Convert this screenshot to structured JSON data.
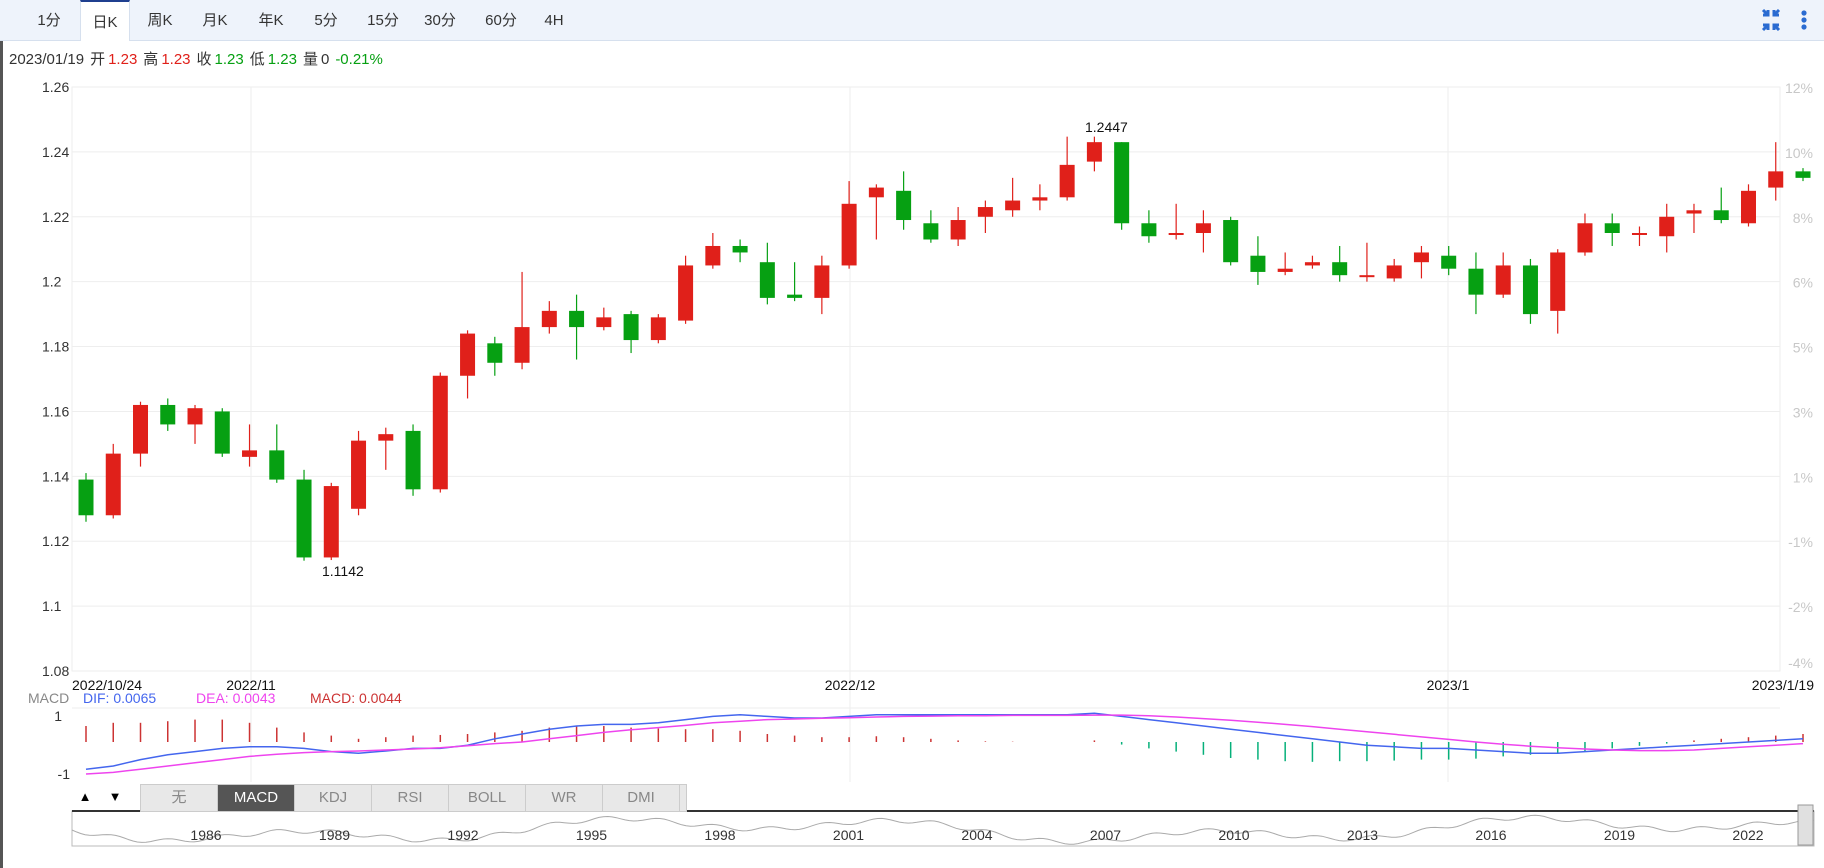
{
  "tabs": [
    {
      "label": "1分",
      "active": false
    },
    {
      "label": "日K",
      "active": true
    },
    {
      "label": "周K",
      "active": false
    },
    {
      "label": "月K",
      "active": false
    },
    {
      "label": "年K",
      "active": false
    },
    {
      "label": "5分",
      "active": false
    },
    {
      "label": "15分",
      "active": false
    },
    {
      "label": "30分",
      "active": false
    },
    {
      "label": "60分",
      "active": false
    },
    {
      "label": "4H",
      "active": false
    }
  ],
  "quote": {
    "date": "2023/01/19",
    "open_label": "开",
    "open": "1.23",
    "high_label": "高",
    "high": "1.23",
    "close_label": "收",
    "close": "1.23",
    "low_label": "低",
    "low": "1.23",
    "volume_label": "量",
    "volume": "0",
    "change": "-0.21%"
  },
  "colors": {
    "up": "#e0201a",
    "down": "#06a012",
    "dif": "#4466ee",
    "dea": "#ee44ee",
    "macd": "#cc3333"
  },
  "macd": {
    "label": "MACD",
    "dif_label": "DIF: 0.0065",
    "dea_label": "DEA: 0.0043",
    "macd_label": "MACD: 0.0044",
    "y_ticks": [
      "1",
      "-1"
    ]
  },
  "indicator_tabs": [
    {
      "label": "无",
      "active": false
    },
    {
      "label": "MACD",
      "active": true
    },
    {
      "label": "KDJ",
      "active": false
    },
    {
      "label": "RSI",
      "active": false
    },
    {
      "label": "BOLL",
      "active": false
    },
    {
      "label": "WR",
      "active": false
    },
    {
      "label": "DMI",
      "active": false
    }
  ],
  "nav_buttons": {
    "up": "▲",
    "down": "▼"
  },
  "overview_years": [
    "1986",
    "1989",
    "1992",
    "1995",
    "1998",
    "2001",
    "2004",
    "2007",
    "2010",
    "2013",
    "2016",
    "2019",
    "2022"
  ],
  "chart_data": {
    "type": "candlestick",
    "y_ticks": [
      "1.26",
      "1.24",
      "1.22",
      "1.2",
      "1.18",
      "1.16",
      "1.14",
      "1.12",
      "1.1",
      "1.08"
    ],
    "ylim": [
      1.08,
      1.26
    ],
    "right_ticks": [
      "12%",
      "10%",
      "8%",
      "6%",
      "5%",
      "3%",
      "1%",
      "-1%",
      "-2%",
      "-4%"
    ],
    "x_labels": [
      "2022/10/24",
      "2022/11",
      "2022/12",
      "2023/1",
      "2023/1/19"
    ],
    "annotations": {
      "high": "1.2447",
      "low": "1.1142"
    },
    "candles": [
      {
        "o": 1.139,
        "h": 1.141,
        "l": 1.126,
        "c": 1.128
      },
      {
        "o": 1.128,
        "h": 1.15,
        "l": 1.127,
        "c": 1.147
      },
      {
        "o": 1.147,
        "h": 1.163,
        "l": 1.143,
        "c": 1.162
      },
      {
        "o": 1.162,
        "h": 1.164,
        "l": 1.154,
        "c": 1.156
      },
      {
        "o": 1.156,
        "h": 1.162,
        "l": 1.15,
        "c": 1.161
      },
      {
        "o": 1.16,
        "h": 1.161,
        "l": 1.146,
        "c": 1.147
      },
      {
        "o": 1.146,
        "h": 1.156,
        "l": 1.143,
        "c": 1.148
      },
      {
        "o": 1.148,
        "h": 1.156,
        "l": 1.138,
        "c": 1.139
      },
      {
        "o": 1.139,
        "h": 1.142,
        "l": 1.114,
        "c": 1.115
      },
      {
        "o": 1.115,
        "h": 1.138,
        "l": 1.1142,
        "c": 1.137
      },
      {
        "o": 1.13,
        "h": 1.154,
        "l": 1.128,
        "c": 1.151
      },
      {
        "o": 1.151,
        "h": 1.155,
        "l": 1.142,
        "c": 1.153
      },
      {
        "o": 1.154,
        "h": 1.156,
        "l": 1.134,
        "c": 1.136
      },
      {
        "o": 1.136,
        "h": 1.172,
        "l": 1.135,
        "c": 1.171
      },
      {
        "o": 1.171,
        "h": 1.185,
        "l": 1.164,
        "c": 1.184
      },
      {
        "o": 1.181,
        "h": 1.183,
        "l": 1.171,
        "c": 1.175
      },
      {
        "o": 1.175,
        "h": 1.203,
        "l": 1.173,
        "c": 1.186
      },
      {
        "o": 1.186,
        "h": 1.194,
        "l": 1.184,
        "c": 1.191
      },
      {
        "o": 1.191,
        "h": 1.196,
        "l": 1.176,
        "c": 1.186
      },
      {
        "o": 1.186,
        "h": 1.192,
        "l": 1.185,
        "c": 1.189
      },
      {
        "o": 1.19,
        "h": 1.191,
        "l": 1.178,
        "c": 1.182
      },
      {
        "o": 1.182,
        "h": 1.19,
        "l": 1.181,
        "c": 1.189
      },
      {
        "o": 1.188,
        "h": 1.208,
        "l": 1.187,
        "c": 1.205
      },
      {
        "o": 1.205,
        "h": 1.215,
        "l": 1.204,
        "c": 1.211
      },
      {
        "o": 1.211,
        "h": 1.213,
        "l": 1.206,
        "c": 1.209
      },
      {
        "o": 1.206,
        "h": 1.212,
        "l": 1.193,
        "c": 1.195
      },
      {
        "o": 1.196,
        "h": 1.206,
        "l": 1.194,
        "c": 1.195
      },
      {
        "o": 1.195,
        "h": 1.208,
        "l": 1.19,
        "c": 1.205
      },
      {
        "o": 1.205,
        "h": 1.231,
        "l": 1.204,
        "c": 1.224
      },
      {
        "o": 1.226,
        "h": 1.23,
        "l": 1.213,
        "c": 1.229
      },
      {
        "o": 1.228,
        "h": 1.234,
        "l": 1.216,
        "c": 1.219
      },
      {
        "o": 1.218,
        "h": 1.222,
        "l": 1.212,
        "c": 1.213
      },
      {
        "o": 1.213,
        "h": 1.223,
        "l": 1.211,
        "c": 1.219
      },
      {
        "o": 1.22,
        "h": 1.225,
        "l": 1.215,
        "c": 1.223
      },
      {
        "o": 1.222,
        "h": 1.232,
        "l": 1.22,
        "c": 1.225
      },
      {
        "o": 1.225,
        "h": 1.23,
        "l": 1.222,
        "c": 1.226
      },
      {
        "o": 1.226,
        "h": 1.2447,
        "l": 1.225,
        "c": 1.236
      },
      {
        "o": 1.237,
        "h": 1.2447,
        "l": 1.234,
        "c": 1.243
      },
      {
        "o": 1.243,
        "h": 1.243,
        "l": 1.216,
        "c": 1.218
      },
      {
        "o": 1.218,
        "h": 1.222,
        "l": 1.212,
        "c": 1.214
      },
      {
        "o": 1.215,
        "h": 1.224,
        "l": 1.213,
        "c": 1.215
      },
      {
        "o": 1.215,
        "h": 1.222,
        "l": 1.209,
        "c": 1.218
      },
      {
        "o": 1.219,
        "h": 1.22,
        "l": 1.205,
        "c": 1.206
      },
      {
        "o": 1.208,
        "h": 1.214,
        "l": 1.199,
        "c": 1.203
      },
      {
        "o": 1.203,
        "h": 1.209,
        "l": 1.202,
        "c": 1.204
      },
      {
        "o": 1.205,
        "h": 1.208,
        "l": 1.204,
        "c": 1.206
      },
      {
        "o": 1.206,
        "h": 1.211,
        "l": 1.2,
        "c": 1.202
      },
      {
        "o": 1.202,
        "h": 1.212,
        "l": 1.2,
        "c": 1.202
      },
      {
        "o": 1.201,
        "h": 1.207,
        "l": 1.2,
        "c": 1.205
      },
      {
        "o": 1.206,
        "h": 1.211,
        "l": 1.201,
        "c": 1.209
      },
      {
        "o": 1.208,
        "h": 1.211,
        "l": 1.202,
        "c": 1.204
      },
      {
        "o": 1.204,
        "h": 1.209,
        "l": 1.19,
        "c": 1.196
      },
      {
        "o": 1.196,
        "h": 1.209,
        "l": 1.195,
        "c": 1.205
      },
      {
        "o": 1.205,
        "h": 1.207,
        "l": 1.187,
        "c": 1.19
      },
      {
        "o": 1.191,
        "h": 1.21,
        "l": 1.184,
        "c": 1.209
      },
      {
        "o": 1.209,
        "h": 1.221,
        "l": 1.208,
        "c": 1.218
      },
      {
        "o": 1.218,
        "h": 1.221,
        "l": 1.211,
        "c": 1.215
      },
      {
        "o": 1.215,
        "h": 1.217,
        "l": 1.211,
        "c": 1.215
      },
      {
        "o": 1.214,
        "h": 1.224,
        "l": 1.209,
        "c": 1.22
      },
      {
        "o": 1.221,
        "h": 1.224,
        "l": 1.215,
        "c": 1.222
      },
      {
        "o": 1.222,
        "h": 1.229,
        "l": 1.218,
        "c": 1.219
      },
      {
        "o": 1.218,
        "h": 1.23,
        "l": 1.217,
        "c": 1.228
      },
      {
        "o": 1.229,
        "h": 1.243,
        "l": 1.225,
        "c": 1.234
      },
      {
        "o": 1.234,
        "h": 1.235,
        "l": 1.231,
        "c": 1.232
      }
    ],
    "macd_series": {
      "dif": [
        -0.85,
        -0.75,
        -0.55,
        -0.4,
        -0.3,
        -0.2,
        -0.15,
        -0.15,
        -0.2,
        -0.3,
        -0.35,
        -0.28,
        -0.2,
        -0.2,
        -0.1,
        0.1,
        0.25,
        0.4,
        0.5,
        0.55,
        0.55,
        0.6,
        0.7,
        0.8,
        0.85,
        0.8,
        0.75,
        0.75,
        0.8,
        0.85,
        0.85,
        0.85,
        0.85,
        0.85,
        0.85,
        0.85,
        0.85,
        0.9,
        0.8,
        0.7,
        0.6,
        0.5,
        0.4,
        0.3,
        0.2,
        0.1,
        0.0,
        -0.1,
        -0.15,
        -0.2,
        -0.2,
        -0.25,
        -0.3,
        -0.35,
        -0.35,
        -0.3,
        -0.25,
        -0.2,
        -0.15,
        -0.1,
        -0.05,
        0.0,
        0.05,
        0.1
      ],
      "dea": [
        -1.0,
        -0.95,
        -0.85,
        -0.75,
        -0.65,
        -0.55,
        -0.45,
        -0.38,
        -0.33,
        -0.3,
        -0.28,
        -0.25,
        -0.22,
        -0.18,
        -0.12,
        -0.05,
        0.0,
        0.1,
        0.2,
        0.3,
        0.38,
        0.45,
        0.52,
        0.6,
        0.65,
        0.7,
        0.72,
        0.74,
        0.76,
        0.78,
        0.8,
        0.81,
        0.82,
        0.82,
        0.83,
        0.83,
        0.83,
        0.84,
        0.84,
        0.82,
        0.78,
        0.73,
        0.68,
        0.62,
        0.55,
        0.48,
        0.4,
        0.32,
        0.24,
        0.16,
        0.08,
        0.0,
        -0.07,
        -0.13,
        -0.18,
        -0.22,
        -0.25,
        -0.27,
        -0.27,
        -0.25,
        -0.2,
        -0.15,
        -0.1,
        -0.05
      ],
      "hist": [
        0.5,
        0.6,
        0.6,
        0.65,
        0.7,
        0.7,
        0.6,
        0.45,
        0.3,
        0.2,
        0.1,
        0.15,
        0.2,
        0.22,
        0.25,
        0.3,
        0.35,
        0.45,
        0.5,
        0.5,
        0.45,
        0.42,
        0.4,
        0.4,
        0.35,
        0.25,
        0.2,
        0.15,
        0.15,
        0.18,
        0.15,
        0.1,
        0.05,
        0.02,
        0.01,
        0.0,
        0.0,
        0.05,
        -0.08,
        -0.2,
        -0.3,
        -0.4,
        -0.5,
        -0.55,
        -0.6,
        -0.62,
        -0.6,
        -0.6,
        -0.58,
        -0.55,
        -0.55,
        -0.52,
        -0.45,
        -0.4,
        -0.35,
        -0.28,
        -0.2,
        -0.12,
        -0.05,
        0.05,
        0.1,
        0.15,
        0.2,
        0.25
      ]
    }
  }
}
